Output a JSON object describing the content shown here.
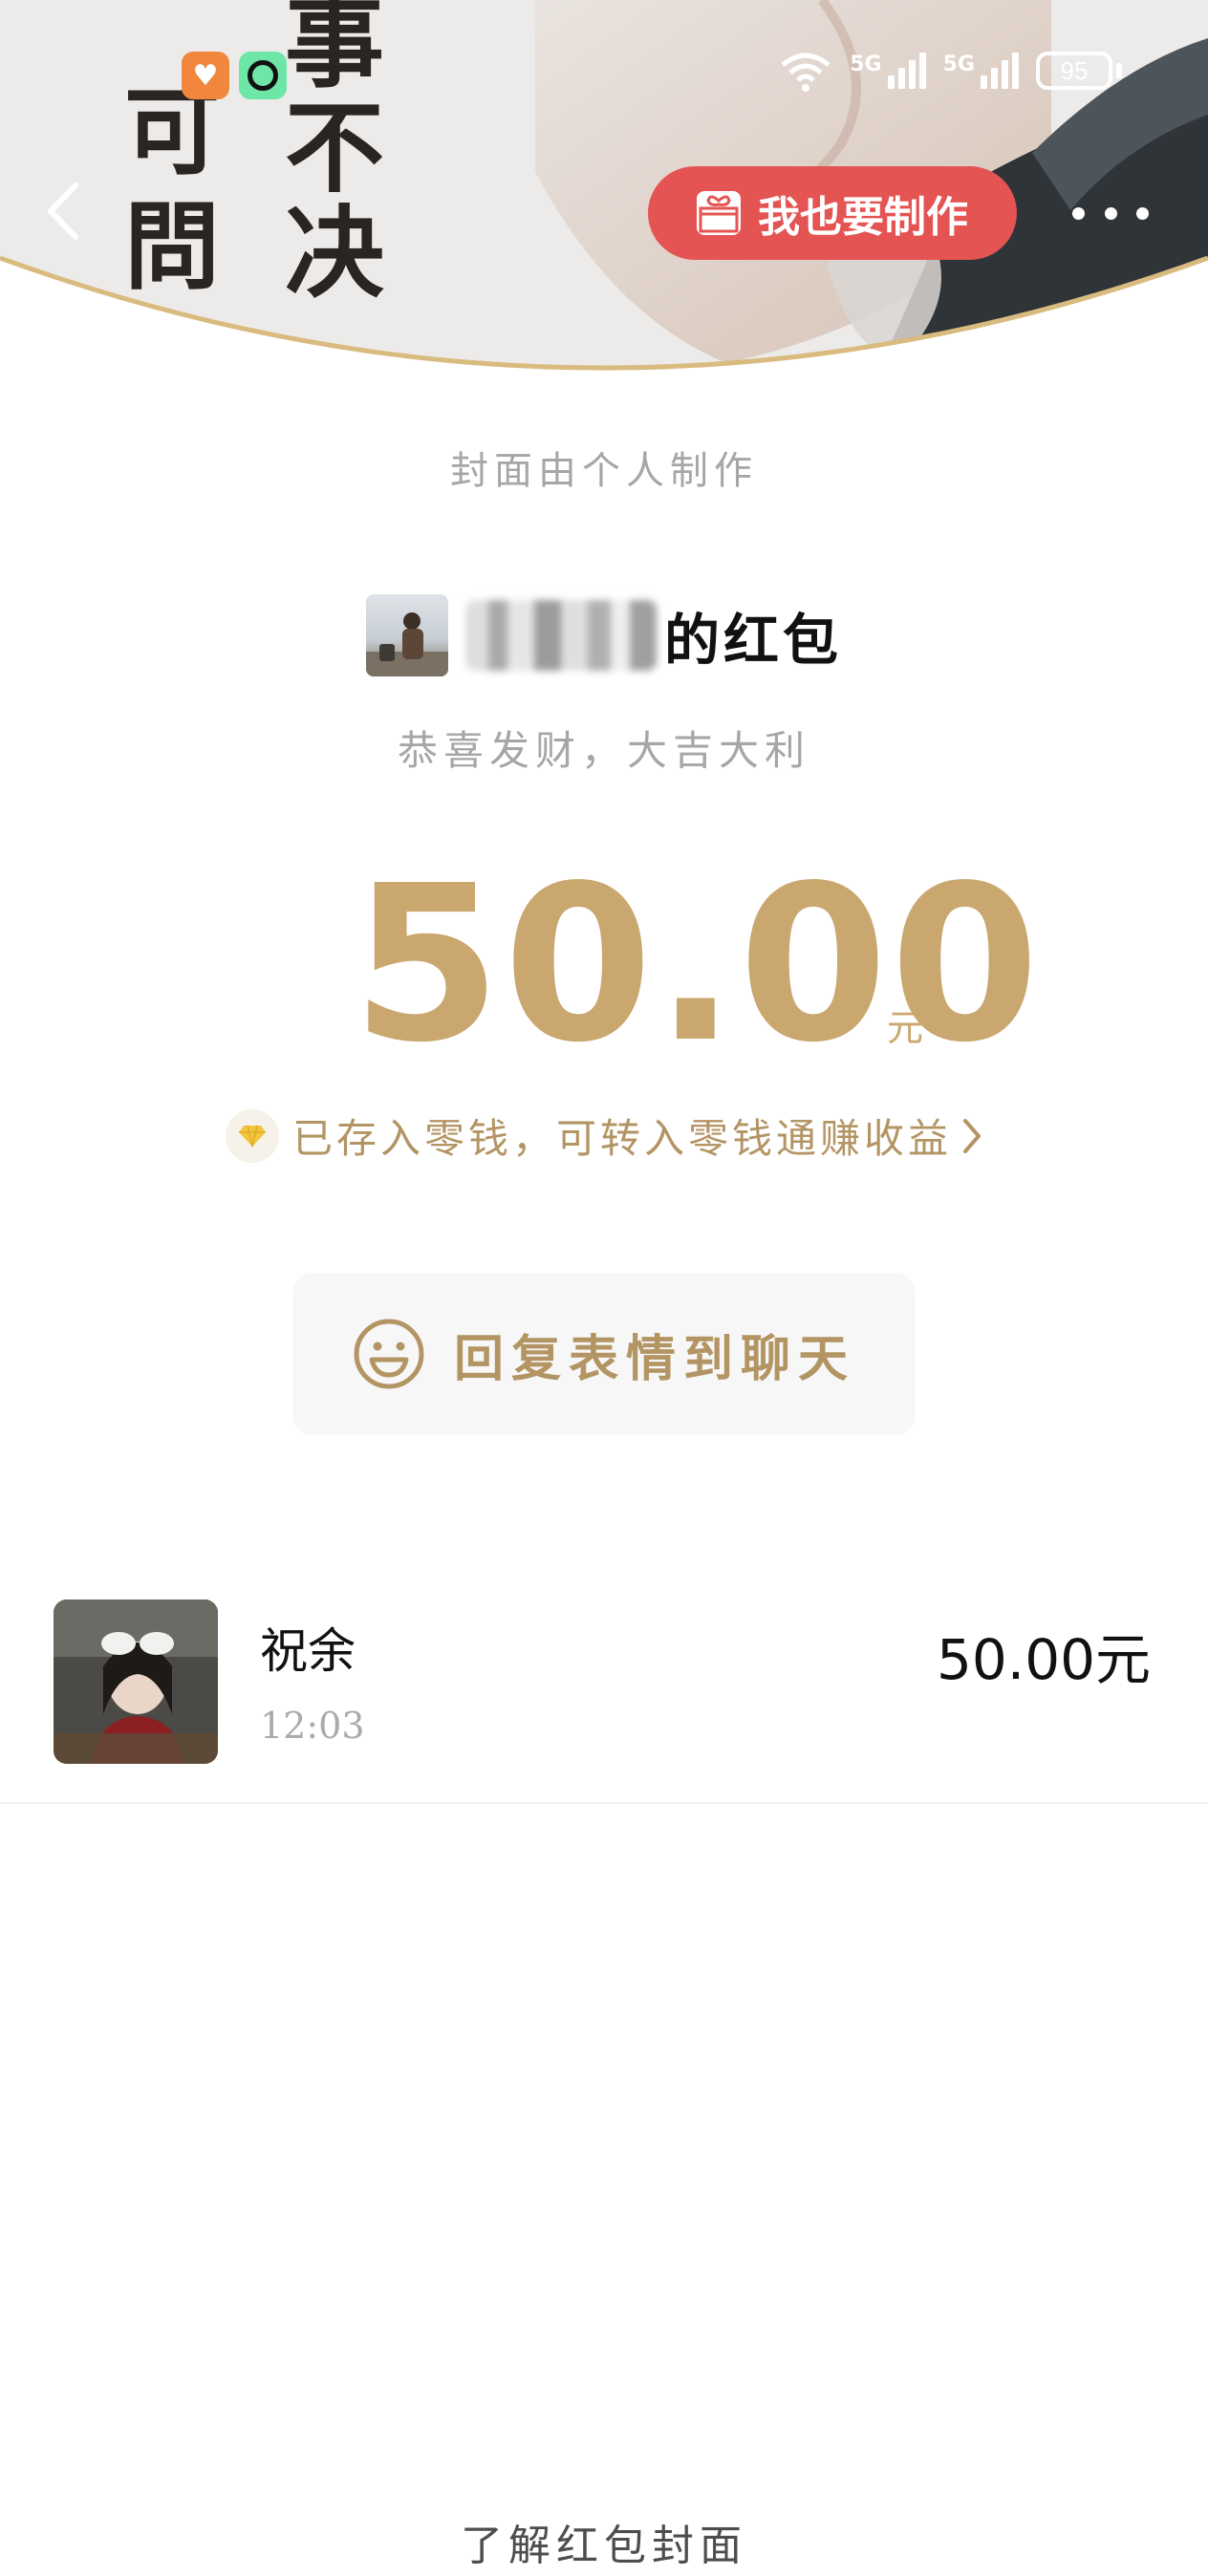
{
  "status_bar": {
    "signal_1": "5G",
    "signal_2": "5G",
    "wifi_tag": "6",
    "battery": "95"
  },
  "cover": {
    "calligraphy_1": "事不决",
    "calligraphy_2": "可問"
  },
  "header": {
    "make_button_label": "我也要制作"
  },
  "cover_note": "封面由个人制作",
  "sender": {
    "name_suffix": "的红包"
  },
  "blessing": "恭喜发财，大吉大利",
  "amount": {
    "value": "50.00",
    "unit": "元"
  },
  "saved_notice": "已存入零钱，可转入零钱通赚收益",
  "reply_button_label": "回复表情到聊天",
  "receiver": {
    "name": "祝余",
    "time": "12:03",
    "amount": "50.00元"
  },
  "footer_link": "了解红包封面",
  "colors": {
    "gold": "#c9a76f",
    "red_button": "#e35453"
  }
}
